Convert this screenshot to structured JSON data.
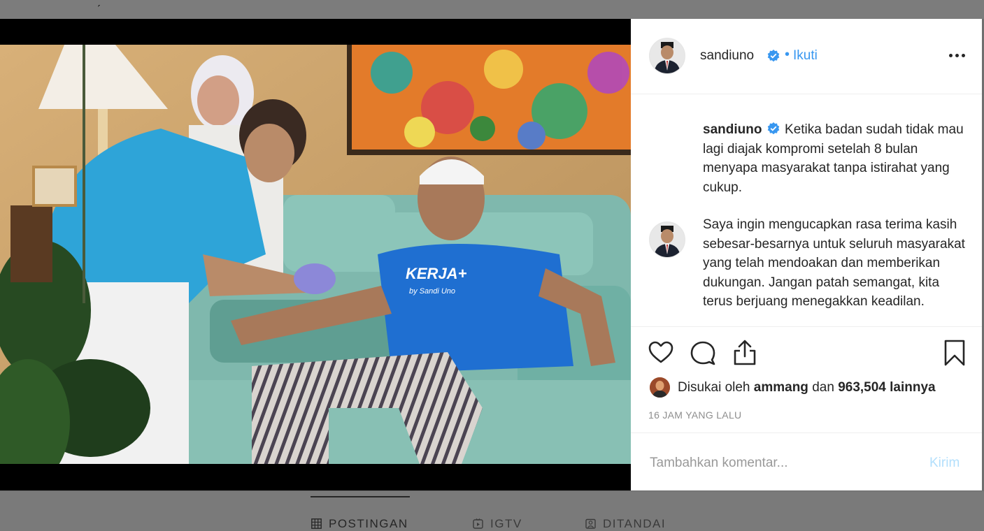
{
  "post": {
    "author": "sandiuno",
    "follow_label": "Ikuti",
    "dot": "•",
    "caption_username": "sandiuno",
    "caption_p1": "Ketika badan sudah tidak mau lagi diajak kompromi setelah 8 bulan menyapa masyarakat tanpa istirahat yang cukup.",
    "caption_p2": "Saya ingin mengucapkan rasa terima kasih sebesar-besarnya untuk seluruh masyarakat yang telah mendoakan dan memberikan dukungan. Jangan patah semangat, kita terus berjuang menegakkan keadilan.",
    "likes_prefix": "Disukai oleh",
    "likes_user": "ammang",
    "likes_mid": "dan",
    "likes_count": "963,504 lainnya",
    "timestamp": "16 JAM YANG LALU",
    "comment_placeholder": "Tambahkan komentar...",
    "post_button": "Kirim",
    "photo_shirt_text": "KERJA+",
    "photo_shirt_sub": "by Sandi Uno"
  },
  "tabs": [
    {
      "label": "POSTINGAN",
      "icon": "grid-icon"
    },
    {
      "label": "IGTV",
      "icon": "igtv-icon"
    },
    {
      "label": "DITANDAI",
      "icon": "tagged-icon"
    }
  ],
  "colors": {
    "accent": "#3897f0",
    "text": "#262626",
    "muted": "#8e8e8e",
    "post_disabled": "#b2dffc",
    "backdrop": "#7a7a7a"
  }
}
